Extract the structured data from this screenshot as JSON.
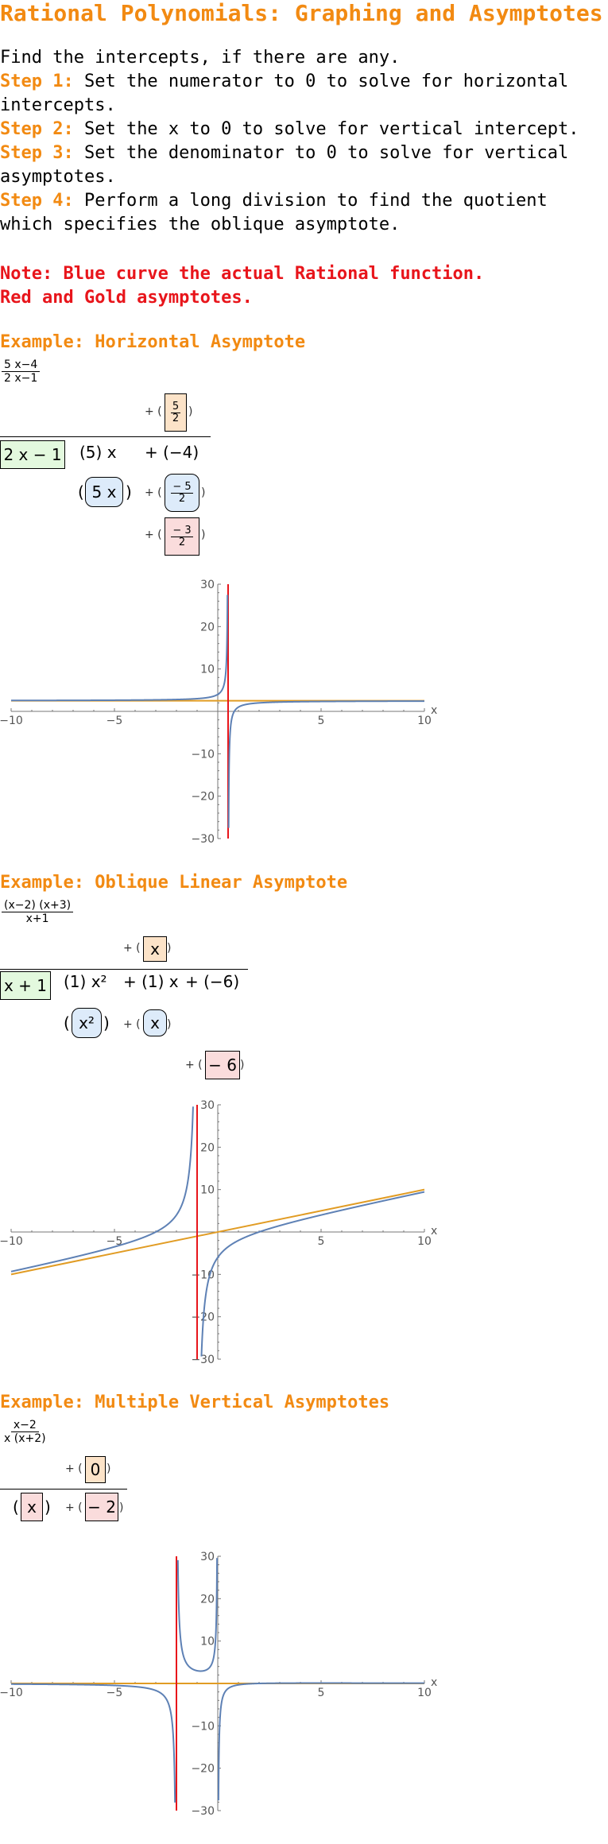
{
  "title": "Rational Polynomials: Graphing and Asymptotes",
  "intro": {
    "line1": "Find the intercepts, if there are any.",
    "steps": [
      {
        "label": "Step 1:",
        "text": " Set the numerator to 0 to solve for horizontal intercepts."
      },
      {
        "label": "Step 2:",
        "text": " Set the x to 0 to solve for vertical intercept."
      },
      {
        "label": "Step 3:",
        "text": " Set the denominator to 0 to solve for vertical asymptotes."
      },
      {
        "label": "Step 4:",
        "text": " Perform a long division to find the quotient which specifies the oblique asymptote."
      }
    ]
  },
  "note": {
    "line1": "Note: Blue curve the actual Rational function.",
    "line2": "Red and Gold asymptotes."
  },
  "colors": {
    "accent_orange": "#F28A12",
    "note_red": "#E8151B",
    "curve_blue": "#5E81B5",
    "asymptote_red": "#E8151B",
    "asymptote_gold": "#E19C24"
  },
  "examples": [
    {
      "heading": "Example: Horizontal Asymptote",
      "expr": {
        "num": "5 x−4",
        "den": "2 x−1"
      },
      "division": {
        "quotient": {
          "prefix": "+ (",
          "num": "5",
          "den": "2",
          "suffix": ")"
        },
        "divisor": "2 x − 1",
        "dividend": [
          "(5) x",
          "+ (−4)"
        ],
        "product": {
          "term1": "5 x",
          "prefix": "+ (",
          "num": "− 5",
          "den": "2",
          "suffix": ")"
        },
        "remainder": {
          "prefix": "+ (",
          "num": "− 3",
          "den": "2",
          "suffix": ")"
        }
      }
    },
    {
      "heading": "Example: Oblique Linear Asymptote",
      "expr": {
        "num": "(x−2) (x+3)",
        "den": "x+1"
      },
      "division": {
        "quotient": {
          "prefix": "+ (",
          "term": "x",
          "suffix": ")"
        },
        "divisor": "x + 1",
        "dividend": [
          "(1) x²",
          "+ (1) x",
          "+ (−6)"
        ],
        "product": {
          "term1": "x²",
          "prefix": "+ (",
          "term2": "x",
          "suffix": ")"
        },
        "remainder": {
          "prefix": "+ (",
          "term": "− 6",
          "suffix": ")"
        }
      }
    },
    {
      "heading": "Example: Multiple Vertical Asymptotes",
      "expr": {
        "num": "x−2",
        "den": "x (x+2)"
      },
      "division": {
        "quotient": {
          "prefix": "+ (",
          "term": "0",
          "suffix": ")"
        },
        "factor1": "x",
        "factor2_prefix": "+ (",
        "factor2": "− 2",
        "suffix": ")"
      }
    }
  ],
  "chart_data": [
    {
      "type": "line",
      "function": "(5x-4)/(2x-1)",
      "xlim": [
        -10,
        10
      ],
      "ylim": [
        -30,
        30
      ],
      "xticks": [
        "−10",
        "−5",
        "5",
        "10"
      ],
      "yticks": [
        "30",
        "20",
        "10",
        "−10",
        "−20",
        "−30"
      ],
      "xlabel": "x",
      "vertical_asymptotes": [
        0.5
      ],
      "horizontal_asymptote": 2.5,
      "grid": false
    },
    {
      "type": "line",
      "function": "(x-2)(x+3)/(x+1)",
      "xlim": [
        -10,
        10
      ],
      "ylim": [
        -30,
        30
      ],
      "xticks": [
        "−10",
        "−5",
        "5",
        "10"
      ],
      "yticks": [
        "30",
        "20",
        "10",
        "−10",
        "−20",
        "−30"
      ],
      "xlabel": "x",
      "vertical_asymptotes": [
        -1
      ],
      "oblique_asymptote": {
        "slope": 1,
        "intercept": 0
      },
      "grid": false
    },
    {
      "type": "line",
      "function": "(x-2)/(x(x+2))",
      "xlim": [
        -10,
        10
      ],
      "ylim": [
        -30,
        30
      ],
      "xticks": [
        "−10",
        "−5",
        "5",
        "10"
      ],
      "yticks": [
        "30",
        "20",
        "10",
        "−10",
        "−20",
        "−30"
      ],
      "xlabel": "x",
      "vertical_asymptotes": [
        -2
      ],
      "horizontal_asymptote": 0,
      "grid": false
    }
  ]
}
